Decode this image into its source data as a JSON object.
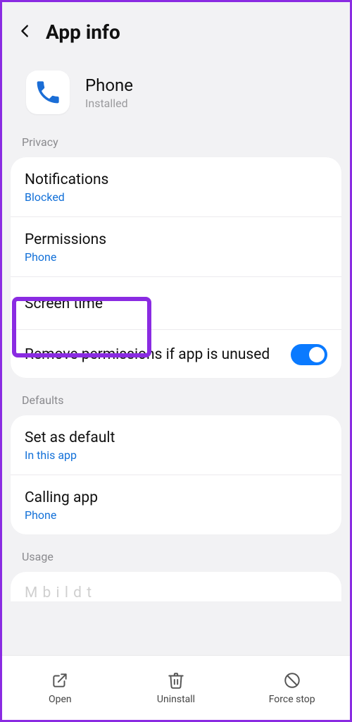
{
  "header": {
    "title": "App info"
  },
  "app": {
    "name": "Phone",
    "status": "Installed"
  },
  "sections": {
    "privacy": {
      "label": "Privacy",
      "notifications": {
        "title": "Notifications",
        "sub": "Blocked"
      },
      "permissions": {
        "title": "Permissions",
        "sub": "Phone"
      },
      "screentime": {
        "title": "Screen time"
      },
      "removeperm": {
        "title": "Remove permissions if app is unused"
      }
    },
    "defaults": {
      "label": "Defaults",
      "setdefault": {
        "title": "Set as default",
        "sub": "In this app"
      },
      "callingapp": {
        "title": "Calling app",
        "sub": "Phone"
      }
    },
    "usage": {
      "label": "Usage",
      "mobiledata": {
        "title": "Mobile data"
      }
    }
  },
  "bottom": {
    "open": "Open",
    "uninstall": "Uninstall",
    "forcestop": "Force stop"
  }
}
